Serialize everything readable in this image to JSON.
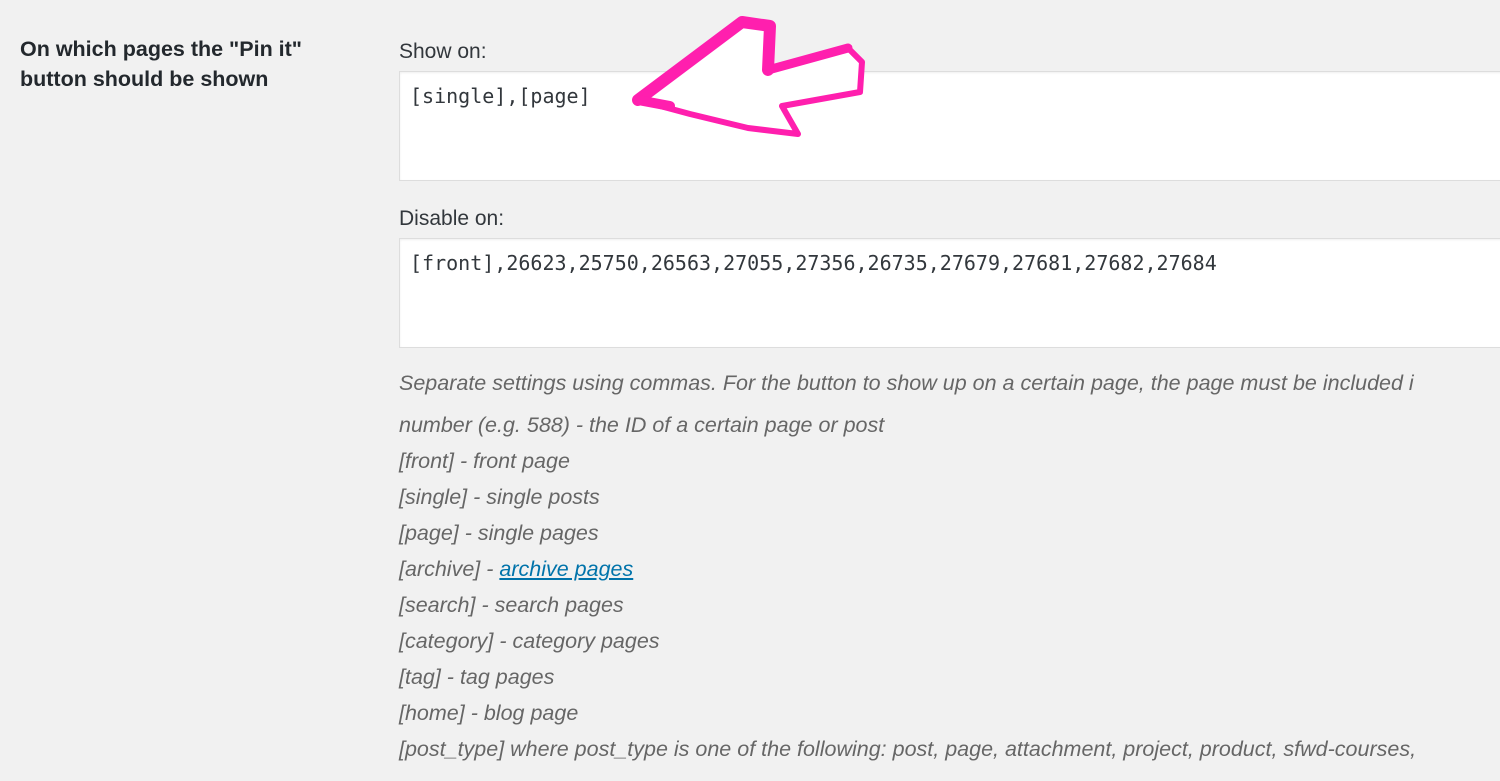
{
  "setting": {
    "row_label": "On which pages the \"Pin it\" button should be shown"
  },
  "show_on": {
    "label": "Show on:",
    "value": "[single],[page]"
  },
  "disable_on": {
    "label": "Disable on:",
    "value": "[front],26623,25750,26563,27055,27356,26735,27679,27681,27682,27684"
  },
  "description": {
    "intro": "Separate settings using commas. For the button to show up on a certain page, the page must be included i",
    "items": [
      "number (e.g. 588) - the ID of a certain page or post",
      "[front] - front page",
      "[single] - single posts",
      "[page] - single pages",
      "[search] - search pages",
      "[category] - category pages",
      "[tag] - tag pages",
      "[home] - blog page",
      "[post_type] where post_type is one of the following: post, page, attachment, project, product, sfwd-courses, "
    ],
    "archive_prefix": "[archive] - ",
    "archive_link": "archive pages"
  },
  "annotation": {
    "arrow_color": "#ff1fae",
    "icon": "hand-drawn-arrow-icon"
  }
}
